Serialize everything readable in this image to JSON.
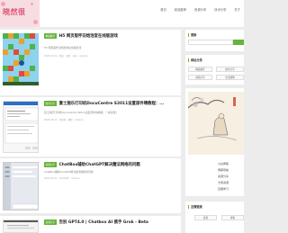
{
  "header": {
    "logo_text": "晓然很",
    "nav": [
      "首页",
      "精品推荐",
      "资源分享",
      "技术分享",
      "关于"
    ]
  },
  "posts": [
    {
      "badge": "精品推荐",
      "title": "H5 网页版怀旧炮泡堂在线版游戏",
      "excerpt": "H5 网页版怀旧炮泡堂在线版游戏",
      "meta": "2023-10-24 · 怀旧 · 游戏 · 分享 · xiaoran"
    },
    {
      "badge": "技术分享",
      "title": "富士施乐打印机DocuCentre S2011设置部件晴教程：...",
      "excerpt": "富士施乐打印机DocuCentre S2011设置部件晴教程：一看就懂！",
      "meta": "2023-08-17 · 打印机 · 教程 · xiaoran"
    },
    {
      "badge": "资源分享",
      "title": "ChatBox辅助ChatGPT解决魔法网络的问题",
      "excerpt": "ChatBox辅助ChatGPT解决魔法网络的问题",
      "meta": "2023-05-11 · ChatGPT · xiaoran"
    },
    {
      "badge": "资源分享",
      "title": "告别 GPT4.0 | Chatbox AI 携手 Grok - Beta"
    }
  ],
  "sidebar": {
    "search_title": "搜索",
    "category_title": "网站分类",
    "categories": [
      "精品推荐",
      "技术分享",
      "资源分享",
      "生活随笔"
    ],
    "links": [
      "小白博客",
      "博客导航",
      "资源分享",
      "大家资源",
      "互相学习"
    ],
    "friends_title": "友情链接",
    "friends": [
      "资源",
      "博客"
    ]
  }
}
